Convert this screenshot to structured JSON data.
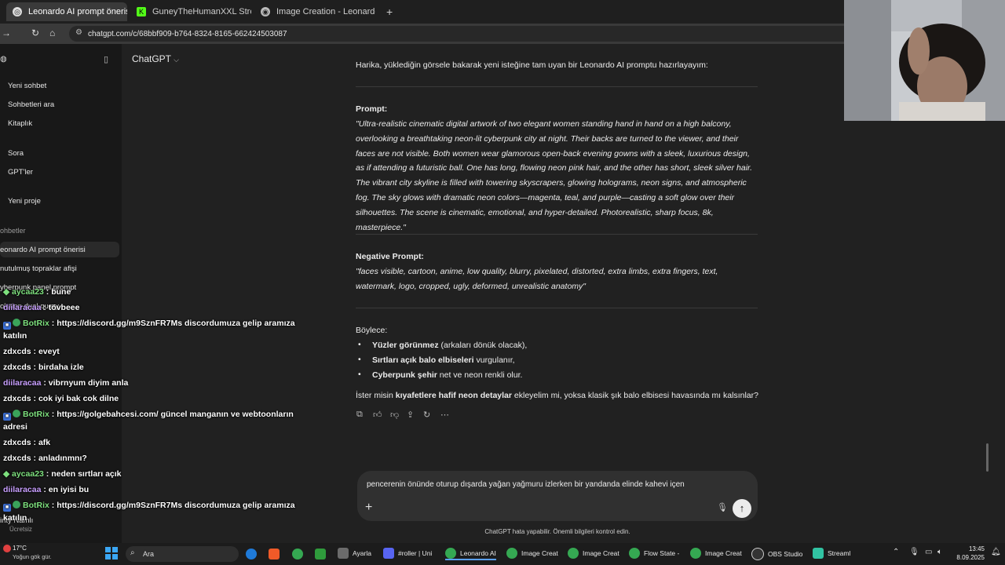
{
  "browser": {
    "tabs": [
      {
        "title": "Leonardo AI prompt önerisi",
        "active": true
      },
      {
        "title": "GuneyTheHumanXXL Stream -",
        "active": false
      },
      {
        "title": "Image Creation - Leonardo.Ai",
        "active": false
      }
    ],
    "new_tab": "+",
    "url": "chatgpt.com/c/68bbf909-b764-8324-8165-662424503087"
  },
  "sidebar": {
    "items": [
      "Yeni sohbet",
      "Sohbetleri ara",
      "Kitaplık",
      "Sora",
      "GPT'ler",
      "Yeni proje"
    ],
    "section_label": "ohbetler",
    "chats": [
      "eonardo AI prompt önerisi",
      "nutulmuş topraklar afişi",
      "yberpunk panel prompt",
      "olution dual query"
    ],
    "footer_name": "inty Namlı",
    "footer_plan": "Ücretsiz"
  },
  "chat_overlay": [
    {
      "user": "aycaa23",
      "text": "bune"
    },
    {
      "user": "diilaracaa",
      "text": "tövbeee"
    },
    {
      "user": "BotRix",
      "text": "https://discord.gg/m9SznFR7Ms discordumuza gelip aramıza"
    },
    {
      "user": "",
      "text": "katılın"
    },
    {
      "user": "zdxcds",
      "text": "eveyt"
    },
    {
      "user": "zdxcds",
      "text": "birdaha izle"
    },
    {
      "user": "diilaracaa",
      "text": "vibrnyum diyim anla"
    },
    {
      "user": "zdxcds",
      "text": "cok iyi bak cok dilne"
    },
    {
      "user": "BotRix",
      "text": "https://golgebahcesi.com/ güncel manganın ve webtoonların"
    },
    {
      "user": "",
      "text": "adresi"
    },
    {
      "user": "zdxcds",
      "text": "afk"
    },
    {
      "user": "zdxcds",
      "text": "anladınmnı?"
    },
    {
      "user": "aycaa23",
      "text": "neden sırtları açık"
    },
    {
      "user": "diilaracaa",
      "text": "en iyisi bu"
    },
    {
      "user": "BotRix",
      "text": "https://discord.gg/m9SznFR7Ms discordumuza gelip aramıza"
    },
    {
      "user": "",
      "text": "katılın"
    }
  ],
  "main": {
    "model_label": "ChatGPT",
    "intro": "Harika, yüklediğin görsele bakarak yeni isteğine tam uyan bir Leonardo AI promptu hazırlayayım:",
    "prompt_label": "Prompt:",
    "prompt_text": "\"Ultra-realistic cinematic digital artwork of two elegant women standing hand in hand on a high balcony, overlooking a breathtaking neon-lit cyberpunk city at night. Their backs are turned to the viewer, and their faces are not visible. Both women wear glamorous open-back evening gowns with a sleek, luxurious design, as if attending a futuristic ball. One has long, flowing neon pink hair, and the other has short, sleek silver hair. The vibrant city skyline is filled with towering skyscrapers, glowing holograms, neon signs, and atmospheric fog. The sky glows with dramatic neon colors—magenta, teal, and purple—casting a soft glow over their silhouettes. The scene is cinematic, emotional, and hyper-detailed. Photorealistic, sharp focus, 8k, masterpiece.\"",
    "neg_label": "Negative Prompt:",
    "neg_text": "\"faces visible, cartoon, anime, low quality, blurry, pixelated, distorted, extra limbs, extra fingers, text, watermark, logo, cropped, ugly, deformed, unrealistic anatomy\"",
    "boylece": "Böylece:",
    "bullets": [
      {
        "bold": "Yüzler görünmez",
        "rest": " (arkaları dönük olacak),"
      },
      {
        "bold": "Sırtları açık balo elbiseleri",
        "rest": " vurgulanır,"
      },
      {
        "bold": "Cyberpunk şehir",
        "rest": " net ve neon renkli olur."
      }
    ],
    "question_pre": "İster misin ",
    "question_bold": "kıyafetlere hafif neon detaylar",
    "question_post": " ekleyelim mi, yoksa klasik şık balo elbisesi havasında mı kalsınlar?"
  },
  "composer": {
    "text": "pencerenin önünde oturup dışarda yağan yağmuru izlerken bir yandanda elinde kahevi içen",
    "disclaimer": "ChatGPT hata yapabilir. Önemli bilgileri kontrol edin."
  },
  "taskbar": {
    "weather_temp": "17°C",
    "weather_desc": "Yoğun gök gür.",
    "search": "Ara",
    "apps": [
      "Ayarla",
      "#roller | Uni",
      "Leonardo AI",
      "Image Creat",
      "Image Creat",
      "Flow State -",
      "Image Creat",
      "OBS Studio",
      "Streaml"
    ],
    "time": "13:45",
    "date": "8.09.2025"
  }
}
